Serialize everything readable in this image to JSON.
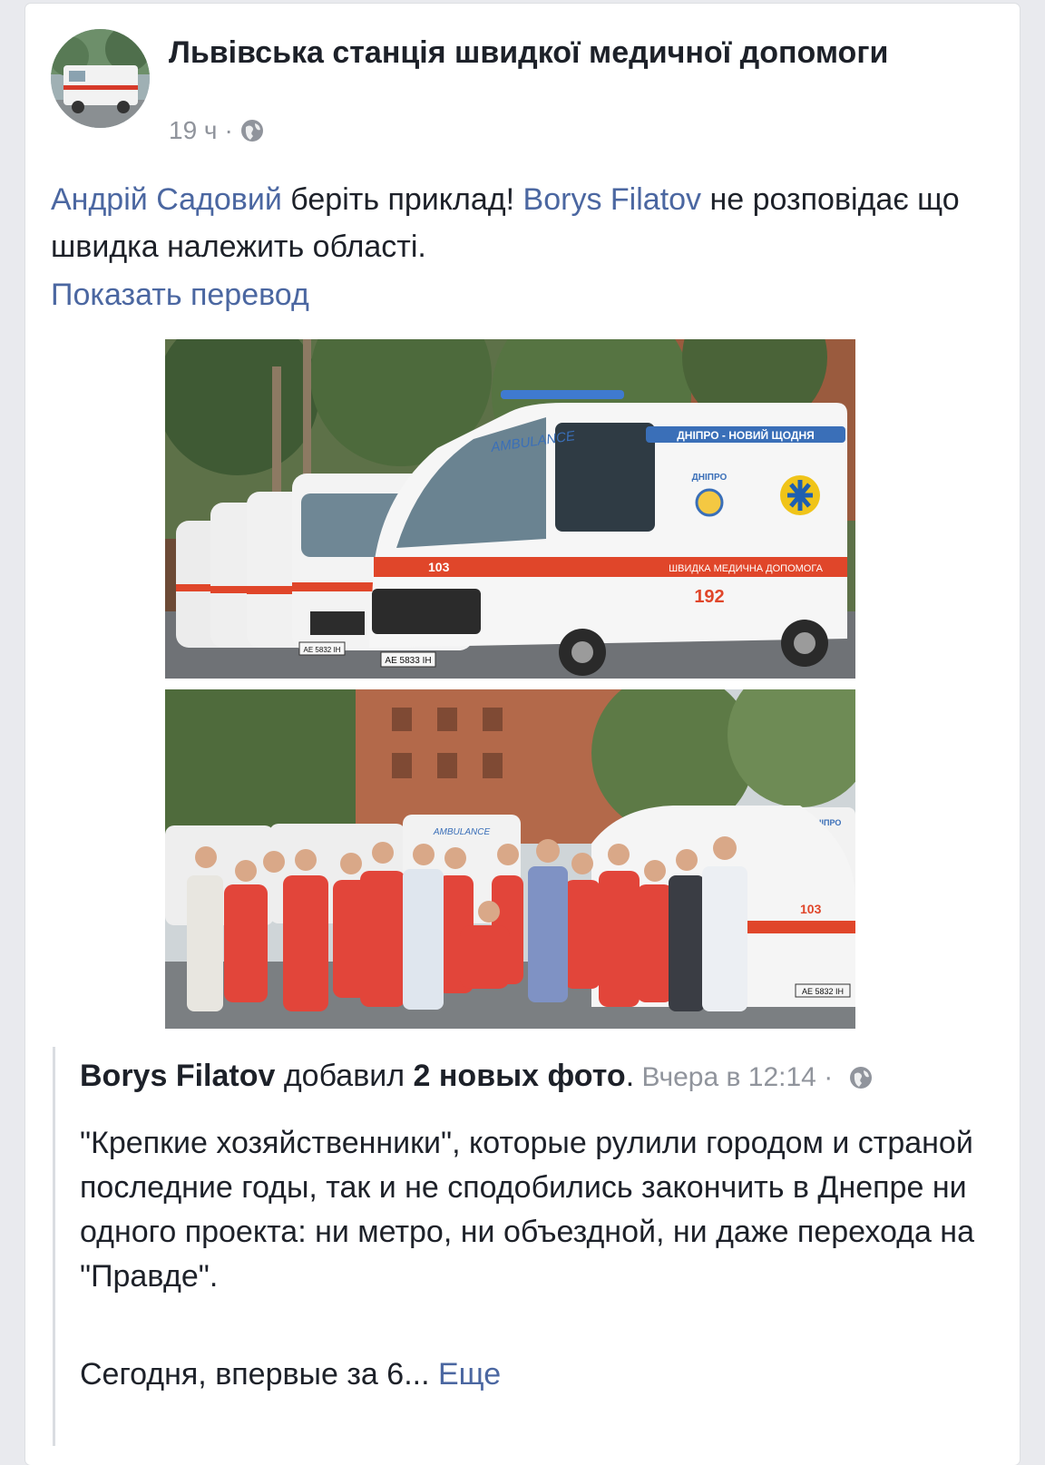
{
  "post": {
    "page_name": "Львівська станція швидкої медичної допомоги",
    "time": "19 ч",
    "separator": "·",
    "privacy_icon": "globe-icon",
    "text": {
      "mention1": "Андрій Садовий",
      "part1": " беріть приклад! ",
      "mention2": "Borys Filatov",
      "part2": " не розповідає що швидка належить області."
    },
    "translate_link": "Показать перевод"
  },
  "shared": {
    "author": "Borys Filatov",
    "action": " добавил ",
    "photos_count": "2 новых фото",
    "period": ".",
    "time": " Вчера в 12:14 ",
    "separator": "·",
    "privacy_icon": "globe-icon",
    "body": "\"Крепкие хозяйственники\", которые рулили городом и страной последние годы, так и не сподобились закончить в Днепре ни одного проекта: ни метро, ни объездной, ни даже перехода на \"Правде\".",
    "teaser": "Сегодня, впервые за 6... ",
    "more_link": "Еще"
  },
  "photo1": {
    "banner": "ДНІПРО - НОВИЙ ЩОДНЯ",
    "logo": "ДНІПРО",
    "stripe": "ШВИДКА МЕДИЧНА ДОПОМОГА",
    "ambulance_word": "AMBULANCE",
    "unit": "103",
    "side_number": "192",
    "plate1": "AE 5833 IH",
    "plate2": "AE 5832 IH"
  },
  "photo2": {
    "ambulance_word": "AMBULANCE",
    "unit": "103",
    "plate": "AE 5832 IH",
    "banner": "ДНІПРО"
  },
  "colors": {
    "link": "#4b67a1",
    "text": "#1d2129",
    "muted": "#90949c",
    "ambulance_red": "#e0462a"
  }
}
